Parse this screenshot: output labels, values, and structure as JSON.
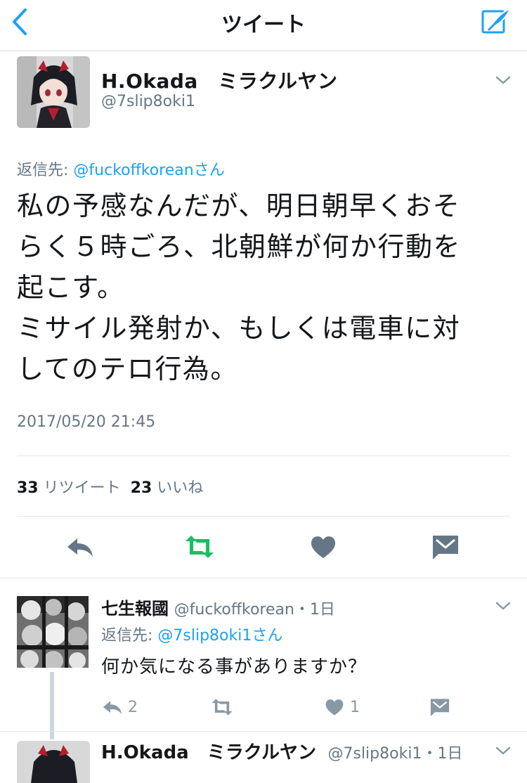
{
  "nav": {
    "title": "ツイート"
  },
  "tweet": {
    "author_name": "H.Okada　ミラクルヤン",
    "author_handle": "@7slip8oki1",
    "reply_prefix": "返信先: ",
    "reply_mention": "@fuckoffkoreanさん",
    "text_lines": [
      "私の予感なんだが、明日朝早くおそ",
      "らく５時ごろ、北朝鮮が何か行動を",
      "起こす。",
      "ミサイル発射か、もしくは電車に対",
      "してのテロ行為。"
    ],
    "timestamp": "2017/05/20 21:45",
    "retweet_count": "33",
    "retweet_label": "リツイート",
    "like_count": "23",
    "like_label": "いいね"
  },
  "reply": {
    "author_name": "七生報國",
    "author_meta": "@fuckoffkorean・1日",
    "reply_prefix": "返信先: ",
    "reply_mention": "@7slip8oki1さん",
    "text": "何か気になる事がありますか？",
    "reply_count": "2",
    "like_count": "1"
  },
  "next": {
    "author_name": "H.Okada　ミラクルヤン",
    "author_meta": "@7slip8oki1・1日"
  },
  "colors": {
    "accent": "#1da1f2",
    "retweet": "#17bf63",
    "icon": "#657786",
    "muted_icon": "#8899a6"
  },
  "icons": [
    "back-chevron-icon",
    "compose-icon",
    "chevron-down-icon",
    "reply-icon",
    "retweet-icon",
    "heart-icon",
    "message-icon"
  ]
}
